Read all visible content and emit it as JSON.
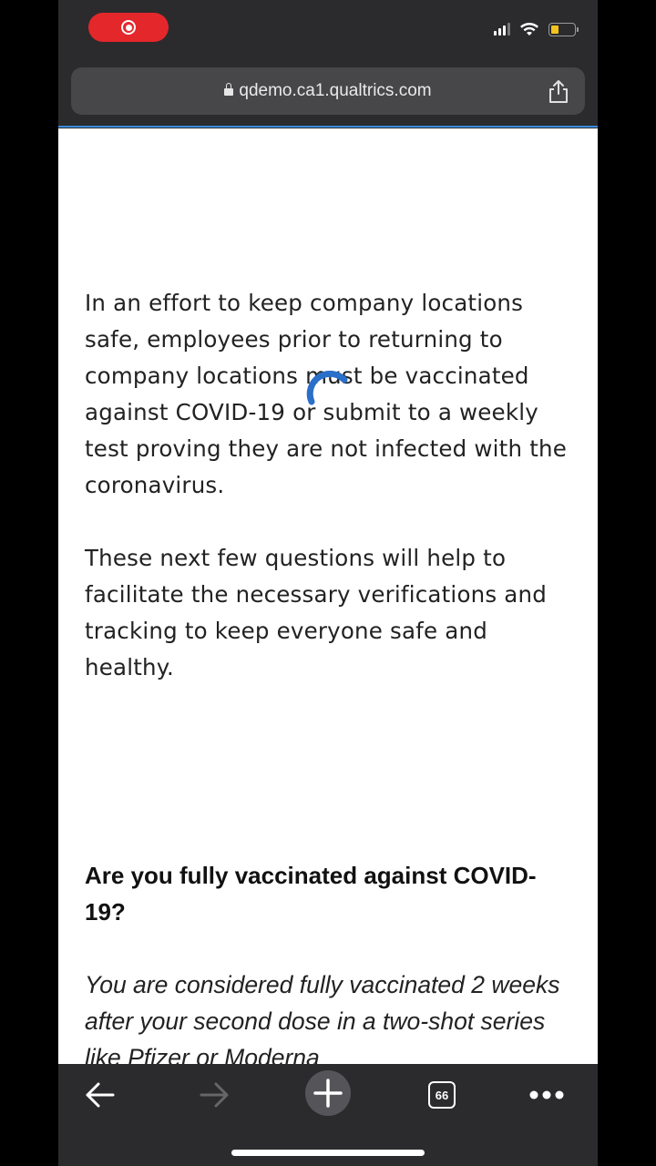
{
  "browser": {
    "url": "qdemo.ca1.qualtrics.com",
    "tab_count": "66"
  },
  "survey": {
    "intro_paragraph_1": "In an effort to keep company locations safe, employees prior to returning to company locations must be vaccinated against COVID-19 or submit to a weekly test proving they are not infected with the coronavirus.",
    "intro_paragraph_2": "These next few questions will help to facilitate the necessary verifications and tracking to keep everyone safe and healthy.",
    "question": "Are you fully vaccinated against COVID-19?",
    "question_note": "You are considered fully vaccinated 2 weeks after your second dose in a two-shot series like Pfizer or Moderna"
  },
  "colors": {
    "recording": "#e4272b",
    "battery": "#f3c21d",
    "spinner": "#2a6fc9",
    "chrome_bg": "#2b2b2d"
  },
  "icons": [
    "record-icon",
    "signal-icon",
    "wifi-icon",
    "battery-icon",
    "lock-icon",
    "share-icon",
    "back-arrow-icon",
    "forward-arrow-icon",
    "new-tab-plus-icon",
    "tabs-icon",
    "more-icon",
    "loading-spinner-icon"
  ]
}
